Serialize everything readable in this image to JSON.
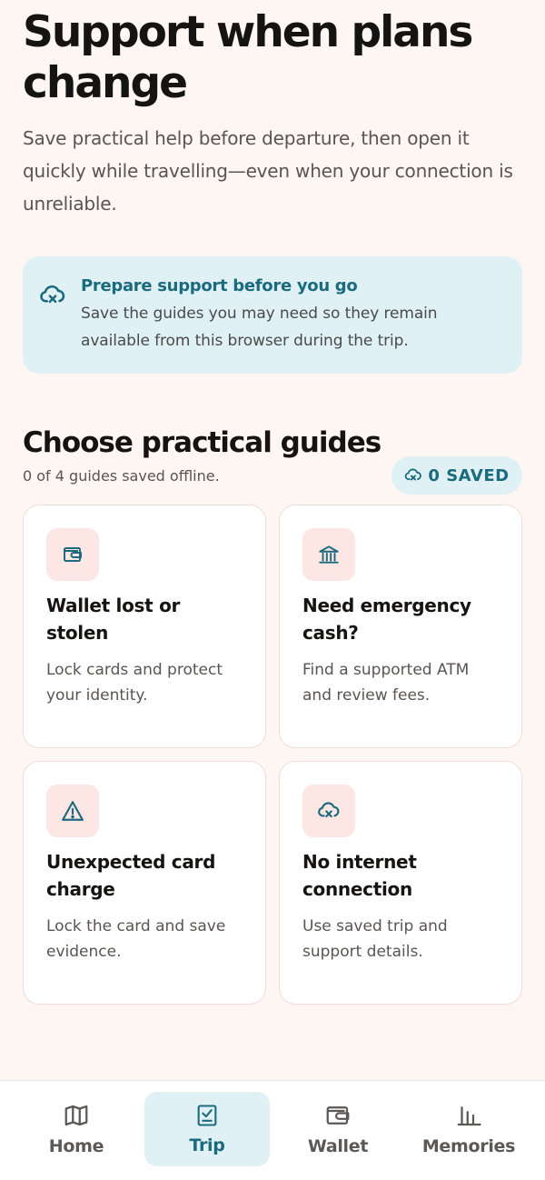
{
  "hero": {
    "title": "Support when plans change",
    "subtitle": "Save practical help before departure, then open it quickly while travelling—even when your connection is unreliable."
  },
  "notice": {
    "icon": "cloud-offline-icon",
    "title": "Prepare support before you go",
    "body": "Save the guides you may need so they remain available from this browser during the trip."
  },
  "guides_section": {
    "title": "Choose practical guides",
    "subtitle": "0 of 4 guides saved offline.",
    "saved_badge": "0 SAVED"
  },
  "guides": [
    {
      "icon": "wallet-icon",
      "title": "Wallet lost or stolen",
      "description": "Lock cards and protect your identity."
    },
    {
      "icon": "bank-icon",
      "title": "Need emergency cash?",
      "description": "Find a supported ATM and review fees."
    },
    {
      "icon": "warning-icon",
      "title": "Unexpected card charge",
      "description": "Lock the card and save evidence."
    },
    {
      "icon": "cloud-offline-icon",
      "title": "No internet connection",
      "description": "Use saved trip and support details."
    }
  ],
  "nav": {
    "items": [
      {
        "label": "Home",
        "icon": "map-icon"
      },
      {
        "label": "Trip",
        "icon": "checklist-icon",
        "active": true
      },
      {
        "label": "Wallet",
        "icon": "wallet-icon"
      },
      {
        "label": "Memories",
        "icon": "bar-chart-icon"
      }
    ]
  },
  "colors": {
    "background": "#fdf6f3",
    "accent": "#1b6a7e",
    "accent_bg": "#dff1f5",
    "icon_tile": "#fde7e4"
  }
}
